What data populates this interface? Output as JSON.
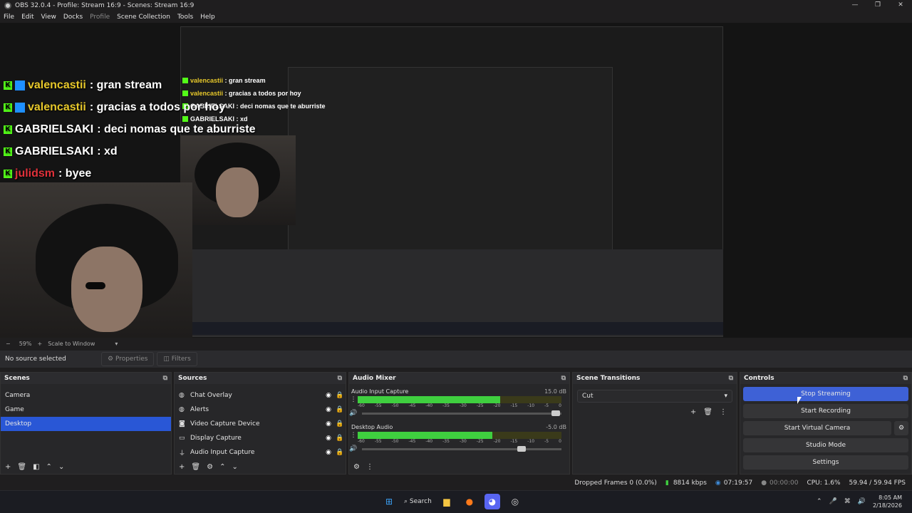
{
  "window": {
    "title": "OBS 32.0.4 - Profile: Stream 16:9 - Scenes: Stream 16:9",
    "controls": [
      "—",
      "❐",
      "✕"
    ]
  },
  "menu": [
    {
      "label": "File",
      "disabled": false
    },
    {
      "label": "Edit",
      "disabled": false
    },
    {
      "label": "View",
      "disabled": false
    },
    {
      "label": "Docks",
      "disabled": false
    },
    {
      "label": "Profile",
      "disabled": true
    },
    {
      "label": "Scene Collection",
      "disabled": false
    },
    {
      "label": "Tools",
      "disabled": false
    },
    {
      "label": "Help",
      "disabled": false
    }
  ],
  "chat": [
    {
      "name": "valencastii",
      "message": ": gran stream",
      "color": "#e6c72a",
      "prime": true
    },
    {
      "name": "valencastii",
      "message": ": gracias a todos por hoy",
      "color": "#e6c72a",
      "prime": true
    },
    {
      "name": "GABRIELSAKI",
      "message": ": deci nomas que te aburriste",
      "color": "#ffffff",
      "prime": false
    },
    {
      "name": "GABRIELSAKI",
      "message": ": xd",
      "color": "#ffffff",
      "prime": false
    },
    {
      "name": "julidsm",
      "message": ": byee",
      "color": "#e0313a",
      "prime": false
    }
  ],
  "zoom": {
    "minus": "−",
    "value": "59%",
    "plus": "+",
    "mode": "Scale to Window"
  },
  "source_bar": {
    "no_source": "No source selected",
    "properties": "Properties",
    "filters": "Filters"
  },
  "scenes": {
    "title": "Scenes",
    "items": [
      "Camera",
      "Game",
      "Desktop"
    ],
    "selected": "Desktop"
  },
  "sources": {
    "title": "Sources",
    "items": [
      {
        "icon": "globe-icon",
        "label": "Chat Overlay"
      },
      {
        "icon": "globe-icon",
        "label": "Alerts"
      },
      {
        "icon": "camera-icon",
        "label": "Video Capture Device"
      },
      {
        "icon": "monitor-icon",
        "label": "Display Capture"
      },
      {
        "icon": "mic-icon",
        "label": "Audio Input Capture"
      }
    ]
  },
  "audio_mixer": {
    "title": "Audio Mixer",
    "channels": [
      {
        "name": "Audio Input Capture",
        "db": "15.0 dB",
        "level": 0.7,
        "volume": 0.95
      },
      {
        "name": "Desktop Audio",
        "db": "-5.0 dB",
        "level": 0.66,
        "volume": 0.78
      }
    ],
    "scale": [
      "-60",
      "-55",
      "-50",
      "-45",
      "-40",
      "-35",
      "-30",
      "-25",
      "-20",
      "-15",
      "-10",
      "-5",
      "0"
    ]
  },
  "transitions": {
    "title": "Scene Transitions",
    "selected": "Cut"
  },
  "controls": {
    "title": "Controls",
    "stop_streaming": "Stop Streaming",
    "start_recording": "Start Recording",
    "start_virtual_camera": "Start Virtual Camera",
    "studio_mode": "Studio Mode",
    "settings": "Settings"
  },
  "status": {
    "dropped_frames": "Dropped Frames 0 (0.0%)",
    "bitrate": "8814 kbps",
    "stream_time": "07:19:57",
    "record_time": "00:00:00",
    "cpu": "CPU: 1.6%",
    "fps": "59.94 / 59.94 FPS"
  },
  "taskbar": {
    "search": "Search",
    "time": "8:05 AM",
    "date": "2/18/2026"
  },
  "colors": {
    "accent": "#3e61d6",
    "selection": "#2957d6",
    "meter_green": "#3fcf3f",
    "meter_yellow": "#d1c23a",
    "meter_red": "#c43a3a"
  }
}
